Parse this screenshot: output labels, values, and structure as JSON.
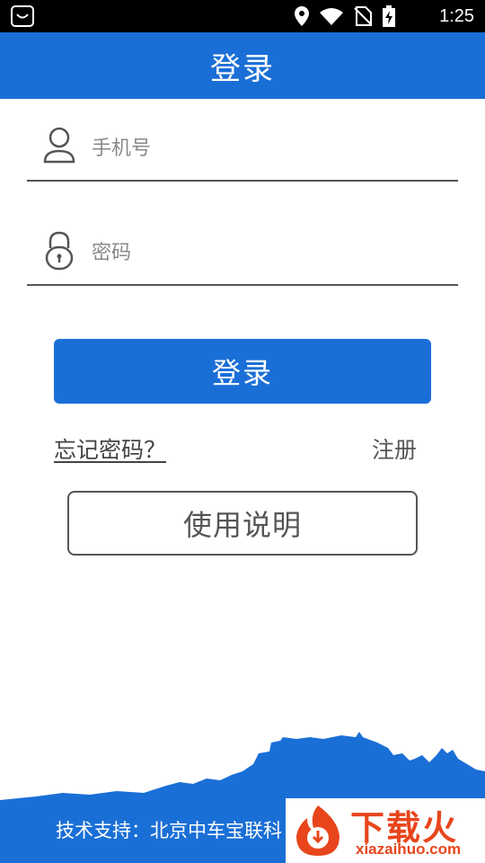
{
  "status_bar": {
    "time": "1:25",
    "icons": [
      "notification-icon",
      "location-icon",
      "wifi-icon",
      "no-sim-icon",
      "battery-charging-icon"
    ]
  },
  "header": {
    "title": "登录"
  },
  "form": {
    "phone": {
      "placeholder": "手机号",
      "value": "",
      "icon": "user-icon"
    },
    "password": {
      "placeholder": "密码",
      "value": "",
      "icon": "lock-icon"
    }
  },
  "actions": {
    "login_label": "登录",
    "forgot_label": "忘记密码？",
    "register_label": "注册",
    "guide_label": "使用说明"
  },
  "footer": {
    "support_text": "技术支持：北京中车宝联科"
  },
  "watermark": {
    "title": "下载火",
    "subtitle": "xiazaihuo.com"
  },
  "colors": {
    "primary": "#1a6fd6",
    "watermark": "#e8451c"
  }
}
